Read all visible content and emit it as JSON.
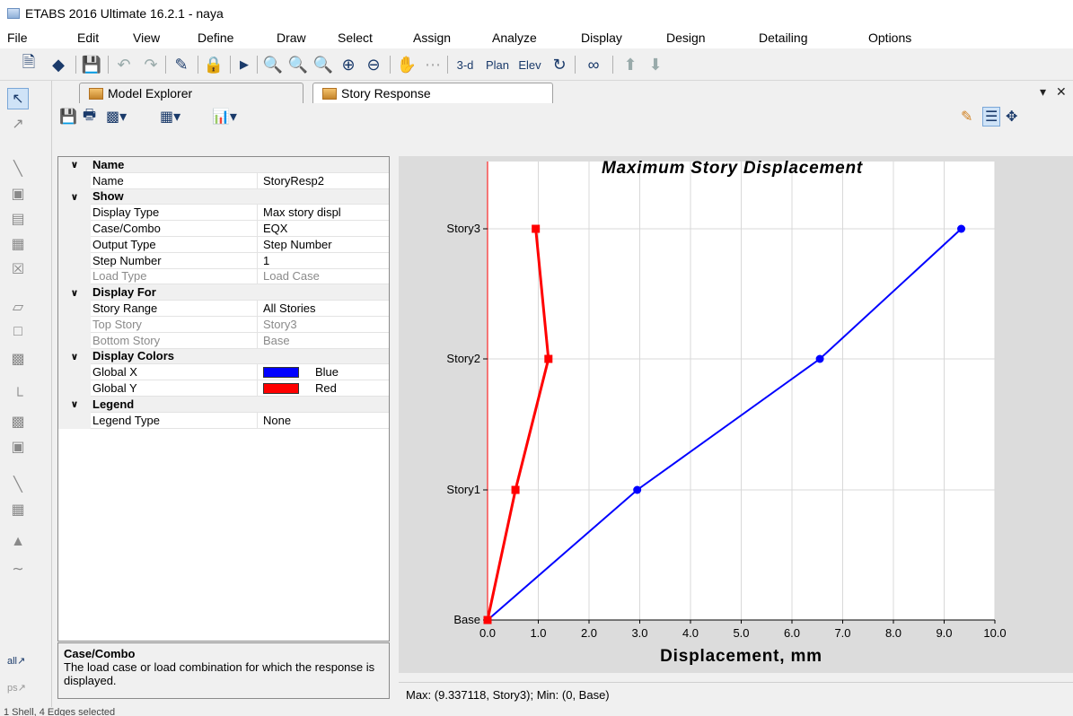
{
  "app": {
    "title": "ETABS 2016 Ultimate 16.2.1 - naya"
  },
  "menu": [
    "File",
    "Edit",
    "View",
    "Define",
    "Draw",
    "Select",
    "Assign",
    "Analyze",
    "Display",
    "Design",
    "Detailing",
    "Options"
  ],
  "toolbar": {
    "view_3d": "3-d",
    "plan": "Plan",
    "elev": "Elev"
  },
  "tabs": [
    {
      "label": "Model Explorer"
    },
    {
      "label": "Story Response"
    }
  ],
  "properties": {
    "rows": [
      {
        "cat": true,
        "name": "Name"
      },
      {
        "name": "Name",
        "value": "StoryResp2"
      },
      {
        "cat": true,
        "name": "Show"
      },
      {
        "name": "Display Type",
        "value": "Max story displ"
      },
      {
        "name": "Case/Combo",
        "value": "EQX"
      },
      {
        "name": "Output Type",
        "value": "Step Number"
      },
      {
        "name": "Step Number",
        "value": "1"
      },
      {
        "name": "Load Type",
        "value": "Load Case",
        "dim": true
      },
      {
        "cat": true,
        "name": "Display For"
      },
      {
        "name": "Story Range",
        "value": "All Stories"
      },
      {
        "name": "Top Story",
        "value": "Story3",
        "dim": true
      },
      {
        "name": "Bottom Story",
        "value": "Base",
        "dim": true
      },
      {
        "cat": true,
        "name": "Display Colors"
      },
      {
        "name": "Global X",
        "value": "Blue",
        "swatch": "#0000ff"
      },
      {
        "name": "Global Y",
        "value": "Red",
        "swatch": "#ff0000"
      },
      {
        "cat": true,
        "name": "Legend"
      },
      {
        "name": "Legend Type",
        "value": "None"
      }
    ]
  },
  "description": {
    "title": "Case/Combo",
    "text": "The load case or load combination for which the response is displayed."
  },
  "status": {
    "text": "Max: (9.337118, Story3);   Min: (0, Base)"
  },
  "bottom": {
    "text": "1 Shell, 4 Edges selected"
  },
  "colors": {
    "global_x": "#0000ff",
    "global_y": "#ff0000"
  },
  "chart_data": {
    "type": "line",
    "title": "Maximum Story Displacement",
    "xlabel": "Displacement, mm",
    "ylabel": "",
    "xlim": [
      0,
      10
    ],
    "x_ticks": [
      "0.0",
      "1.0",
      "2.0",
      "3.0",
      "4.0",
      "5.0",
      "6.0",
      "7.0",
      "8.0",
      "9.0",
      "10.0"
    ],
    "categories": [
      "Base",
      "Story1",
      "Story2",
      "Story3"
    ],
    "grid": true,
    "series": [
      {
        "name": "Global X",
        "color": "#0000ff",
        "marker": "circle",
        "values": [
          0,
          2.95,
          6.55,
          9.337
        ]
      },
      {
        "name": "Global Y",
        "color": "#ff0000",
        "marker": "square",
        "values": [
          0,
          0.55,
          1.2,
          0.95
        ]
      }
    ]
  }
}
